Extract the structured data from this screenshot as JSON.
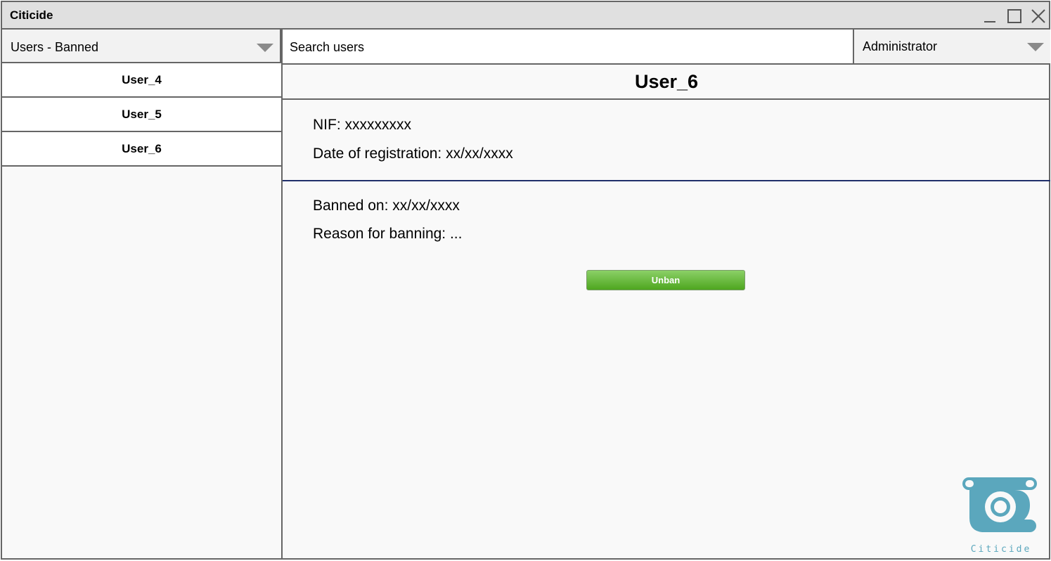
{
  "window": {
    "title": "Citicide",
    "controls": [
      "minimize-icon",
      "maximize-icon",
      "close-icon"
    ]
  },
  "category_dropdown": {
    "selected": "Users - Banned"
  },
  "search": {
    "placeholder": "Search users"
  },
  "role_dropdown": {
    "selected": "Administrator"
  },
  "sidebar": {
    "items": [
      {
        "label": "User_4"
      },
      {
        "label": "User_5"
      },
      {
        "label": "User_6"
      }
    ]
  },
  "detail": {
    "title": "User_6",
    "nif": "NIF: xxxxxxxxx",
    "registration": "Date of registration: xx/xx/xxxx",
    "banned_on": "Banned on: xx/xx/xxxx",
    "reason": "Reason for banning: ...",
    "unban_label": "Unban"
  },
  "logo": {
    "text": "Citicide"
  },
  "colors": {
    "accent_divider": "#1f2f6b",
    "button_green": "#5fb52e",
    "logo_teal": "#5ba7bd"
  }
}
